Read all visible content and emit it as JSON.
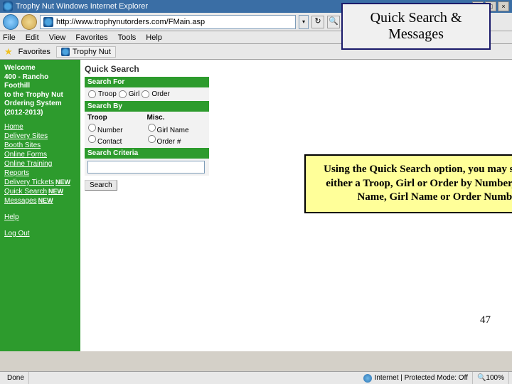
{
  "window": {
    "title": "Trophy Nut  Windows Internet Explorer",
    "min": "_",
    "max": "□",
    "close": "×"
  },
  "address": {
    "url": "http://www.trophynutorders.com/FMain.asp",
    "refresh_glyph": "↻",
    "search_glyph": "🔍",
    "drop_glyph": "▾"
  },
  "menu": {
    "file": "File",
    "edit": "Edit",
    "view": "View",
    "favorites": "Favorites",
    "tools": "Tools",
    "help": "Help"
  },
  "favbar": {
    "label": "Favorites",
    "tab": "Trophy Nut"
  },
  "sidebar": {
    "welcome": "Welcome\n400 - Rancho Foothill\nto the Trophy Nut Ordering System (2012-2013)",
    "links": {
      "home": "Home",
      "delivery_sites": "Delivery Sites",
      "booth_sites": "Booth Sites",
      "online_forms": "Online Forms",
      "online_training": "Online Training",
      "reports": "Reports",
      "delivery_tickets": "Delivery Tickets",
      "quick_search": "Quick Search",
      "messages": "Messages",
      "help": "Help",
      "logout": "Log Out"
    },
    "new_tag": "NEW"
  },
  "quicksearch": {
    "title": "Quick Search",
    "search_for": "Search For",
    "opts_for": {
      "troop": "Troop",
      "girl": "Girl",
      "order": "Order"
    },
    "search_by": "Search By",
    "col_troop": "Troop",
    "col_misc": "Misc.",
    "opts_troop": {
      "number": "Number",
      "contact": "Contact"
    },
    "opts_misc": {
      "girlname": "Girl Name",
      "ordernum": "Order #"
    },
    "criteria": "Search Criteria",
    "button": "Search"
  },
  "overlay": {
    "title": "Quick Search & Messages",
    "box": "Using the Quick Search option, you may search for either a Troop, Girl or Order by Number, Contact Name, Girl Name or Order Number"
  },
  "slide_num": "47",
  "status": {
    "done": "Done",
    "zone": "Internet | Protected Mode: Off",
    "zoom": "100%"
  }
}
